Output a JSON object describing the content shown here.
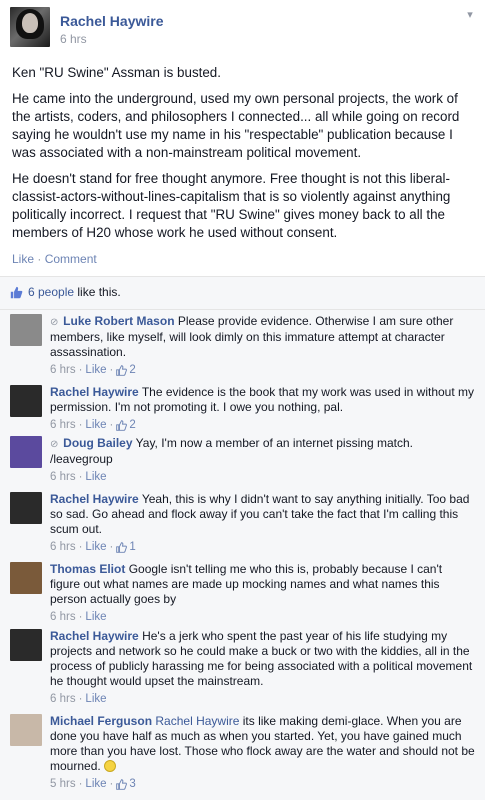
{
  "post": {
    "author": "Rachel Haywire",
    "time": "6 hrs",
    "paragraphs": [
      "Ken \"RU Swine\" Assman is busted.",
      "He came into the underground, used my own personal projects, the work of the artists, coders, and philosophers I connected... all while going on record saying he wouldn't use my name in his \"respectable\" publication because I was associated with a non-mainstream political movement.",
      "He doesn't stand for free thought anymore. Free thought is not this liberal-classist-actors-without-lines-capitalism that is so violently against anything politically incorrect. I request that \"RU Swine\" gives money back to all the members of H20 whose work he used without consent."
    ],
    "like_label": "Like",
    "separator": "·",
    "comment_label": "Comment"
  },
  "likes": {
    "count_text": "6 people",
    "suffix": " like this."
  },
  "comments": [
    {
      "author": "Luke Robert Mason",
      "verified": true,
      "text": "Please provide evidence. Otherwise I am sure other members, like myself, will look dimly on this immature attempt at character assassination.",
      "time": "6 hrs",
      "like_label": "Like",
      "likes": "2",
      "avatar_color": "#8a8a8a"
    },
    {
      "author": "Rachel Haywire",
      "verified": false,
      "text": "The evidence is the book that my work was used in without my permission. I'm not promoting it. I owe you nothing, pal.",
      "time": "6 hrs",
      "like_label": "Like",
      "likes": "2",
      "avatar_color": "#2a2a2a"
    },
    {
      "author": "Doug Bailey",
      "verified": true,
      "text": "Yay, I'm now a member of an internet pissing match. /leavegroup",
      "time": "6 hrs",
      "like_label": "Like",
      "likes": "",
      "avatar_color": "#5b4a9e"
    },
    {
      "author": "Rachel Haywire",
      "verified": false,
      "text": "Yeah, this is why I didn't want to say anything initially. Too bad so sad. Go ahead and flock away if you can't take the fact that I'm calling this scum out.",
      "time": "6 hrs",
      "like_label": "Like",
      "likes": "1",
      "avatar_color": "#2a2a2a"
    },
    {
      "author": "Thomas Eliot",
      "verified": false,
      "text": "Google isn't telling me who this is, probably because I can't figure out what names are made up mocking names and what names this person actually goes by",
      "time": "6 hrs",
      "like_label": "Like",
      "likes": "",
      "avatar_color": "#7a5a3a"
    },
    {
      "author": "Rachel Haywire",
      "verified": false,
      "text": "He's a jerk who spent the past year of his life studying my projects and network so he could make a buck or two with the kiddies, all in the process of publicly harassing me for being associated with a political movement he thought would upset the mainstream.",
      "time": "6 hrs",
      "like_label": "Like",
      "likes": "",
      "avatar_color": "#2a2a2a"
    },
    {
      "author": "Michael Ferguson",
      "verified": false,
      "mention": "Rachel Haywire",
      "text": "its like making demi-glace. When you are done you have half as much as when you started. Yet, you have gained much more than you have lost. Those who flock away are the water and should not be mourned.",
      "time": "5 hrs",
      "like_label": "Like",
      "likes": "3",
      "avatar_color": "#c8b8a8"
    }
  ]
}
